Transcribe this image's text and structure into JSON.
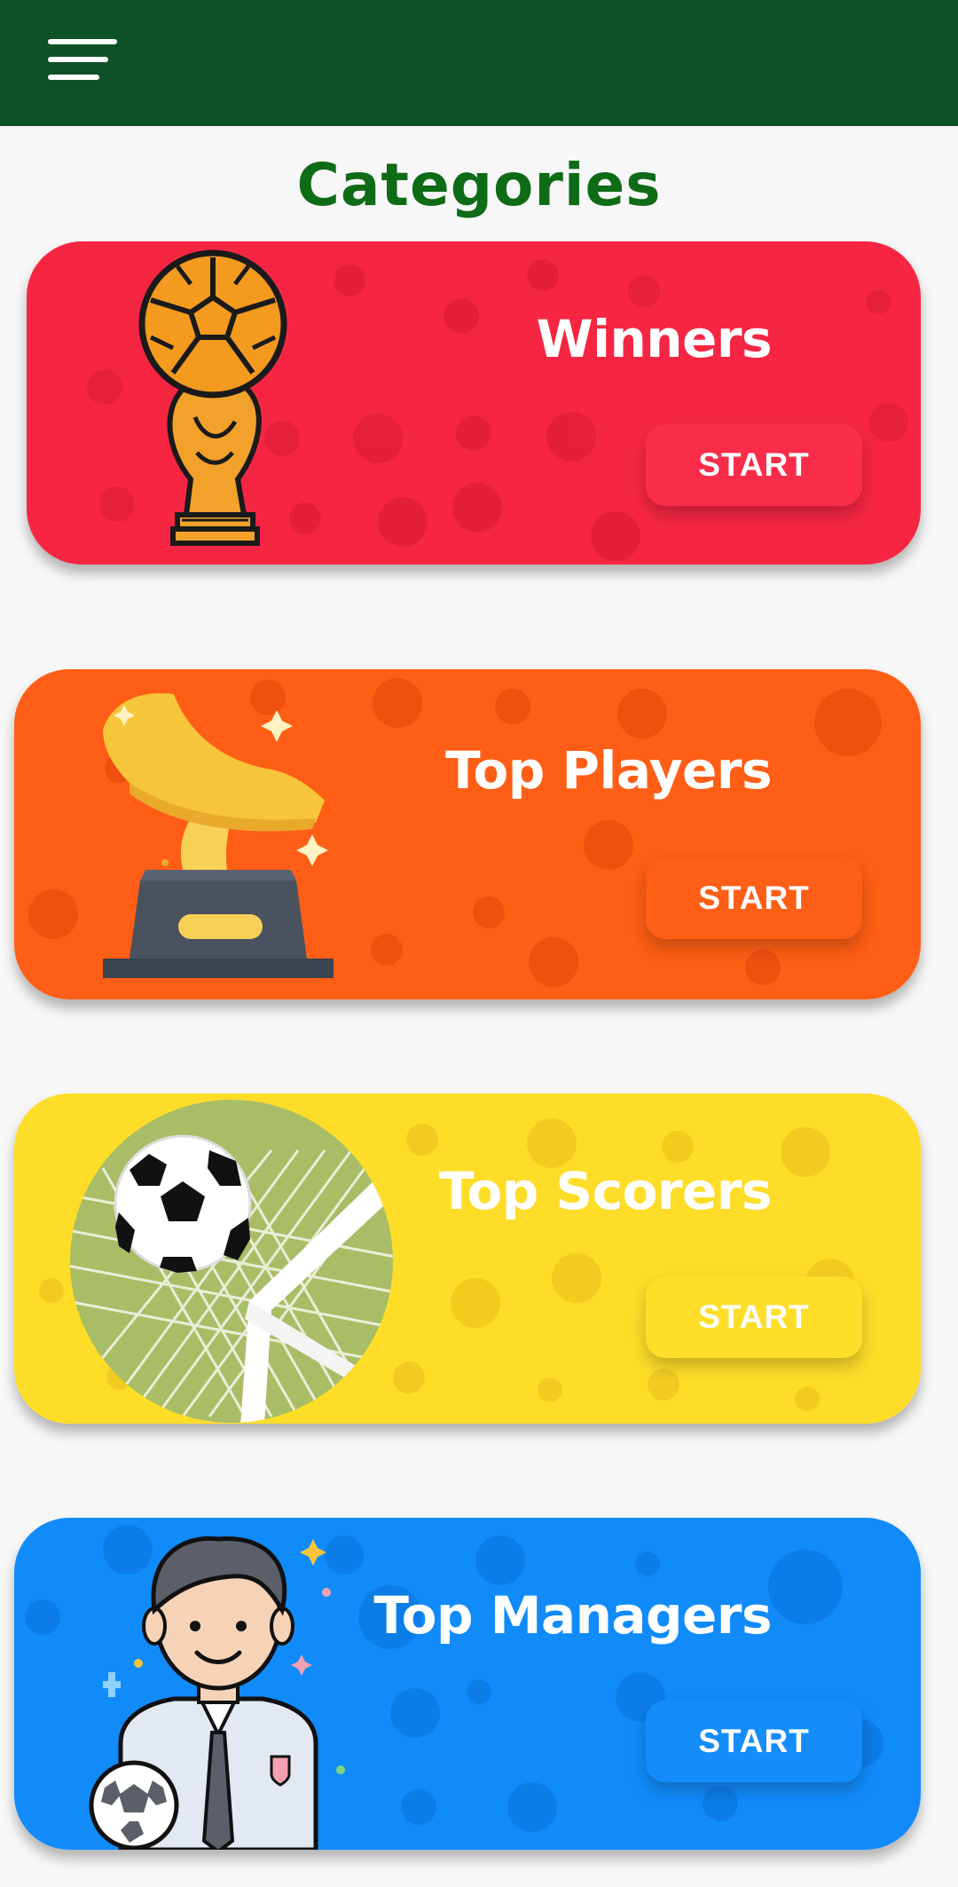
{
  "app_bar": {
    "menu_icon": "hamburger-menu-icon"
  },
  "page": {
    "title": "Categories"
  },
  "categories": [
    {
      "title": "Winners",
      "button_label": "START",
      "icon": "world-cup-trophy-icon",
      "color": "#f62643",
      "button_color": "#f92d4a"
    },
    {
      "title": "Top Players",
      "button_label": "START",
      "icon": "golden-boot-icon",
      "color": "#fe5e15",
      "button_color": "#fe5e15"
    },
    {
      "title": "Top Scorers",
      "button_label": "START",
      "icon": "ball-in-net-icon",
      "color": "#fedd29",
      "button_color": "#fede29"
    },
    {
      "title": "Top Managers",
      "button_label": "START",
      "icon": "manager-avatar-icon",
      "color": "#118bfa",
      "button_color": "#148dfb"
    }
  ]
}
